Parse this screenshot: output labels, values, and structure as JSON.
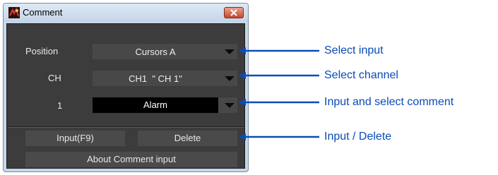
{
  "window": {
    "title": "Comment",
    "close_icon": "close-icon",
    "app_icon": "app-icon"
  },
  "rows": [
    {
      "label": "Position",
      "value": "Cursors A"
    },
    {
      "label": "CH",
      "value": "CH1  \" CH 1\""
    },
    {
      "label": "1",
      "value": "Alarm"
    }
  ],
  "buttons": {
    "input": "Input(F9)",
    "delete": "Delete",
    "about": "About Comment input"
  },
  "callouts": [
    "Select input",
    "Select channel",
    "Input and select comment",
    "Input / Delete"
  ],
  "colors": {
    "callout": "#0a4bb8",
    "panel": "#3c3c3c",
    "close": "#c6462f"
  }
}
